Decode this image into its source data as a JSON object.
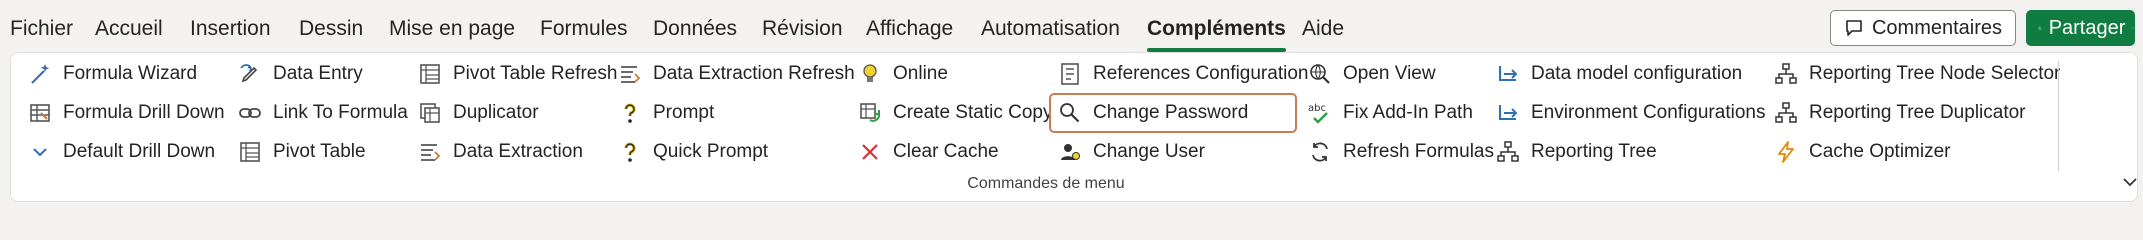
{
  "tabs": [
    "Fichier",
    "Accueil",
    "Insertion",
    "Dessin",
    "Mise en page",
    "Formules",
    "Données",
    "Révision",
    "Affichage",
    "Automatisation",
    "Compléments",
    "Aide"
  ],
  "active_tab": "Compléments",
  "actions": {
    "comments_label": "Commentaires",
    "share_label": "Partager"
  },
  "ribbon": {
    "group_label": "Commandes de menu",
    "commands": [
      {
        "label": "Formula Wizard",
        "icon": "wand-icon"
      },
      {
        "label": "Formula Drill Down",
        "icon": "table-formula-icon"
      },
      {
        "label": "Default Drill Down",
        "icon": "chevron-down-icon"
      },
      {
        "label": "Data Entry",
        "icon": "pencil-arrow-icon"
      },
      {
        "label": "Link To Formula",
        "icon": "link-icon"
      },
      {
        "label": "Pivot Table",
        "icon": "pivot-table-icon"
      },
      {
        "label": "Pivot Table Refresh",
        "icon": "pivot-refresh-icon"
      },
      {
        "label": "Duplicator",
        "icon": "duplicate-icon"
      },
      {
        "label": "Data Extraction",
        "icon": "extraction-icon"
      },
      {
        "label": "Data Extraction Refresh",
        "icon": "extraction-refresh-icon"
      },
      {
        "label": "Prompt",
        "icon": "question-icon"
      },
      {
        "label": "Quick Prompt",
        "icon": "quick-question-icon"
      },
      {
        "label": "Online",
        "icon": "bulb-icon"
      },
      {
        "label": "Create Static Copy",
        "icon": "static-copy-icon"
      },
      {
        "label": "Clear Cache",
        "icon": "close-icon"
      },
      {
        "label": "References Configuration",
        "icon": "references-icon"
      },
      {
        "label": "Change Password",
        "icon": "key-search-icon"
      },
      {
        "label": "Change User",
        "icon": "user-change-icon"
      },
      {
        "label": "Open View",
        "icon": "globe-search-icon"
      },
      {
        "label": "Fix Add-In Path",
        "icon": "abc-check-icon"
      },
      {
        "label": "Refresh Formulas",
        "icon": "refresh-icon"
      },
      {
        "label": "Data model configuration",
        "icon": "data-model-icon"
      },
      {
        "label": "Environment Configurations",
        "icon": "environment-icon"
      },
      {
        "label": "Reporting Tree",
        "icon": "tree-icon"
      },
      {
        "label": "Reporting Tree Node Selector",
        "icon": "tree-select-icon"
      },
      {
        "label": "Reporting Tree Duplicator",
        "icon": "tree-duplicate-icon"
      },
      {
        "label": "Cache Optimizer",
        "icon": "lightning-icon"
      }
    ]
  }
}
